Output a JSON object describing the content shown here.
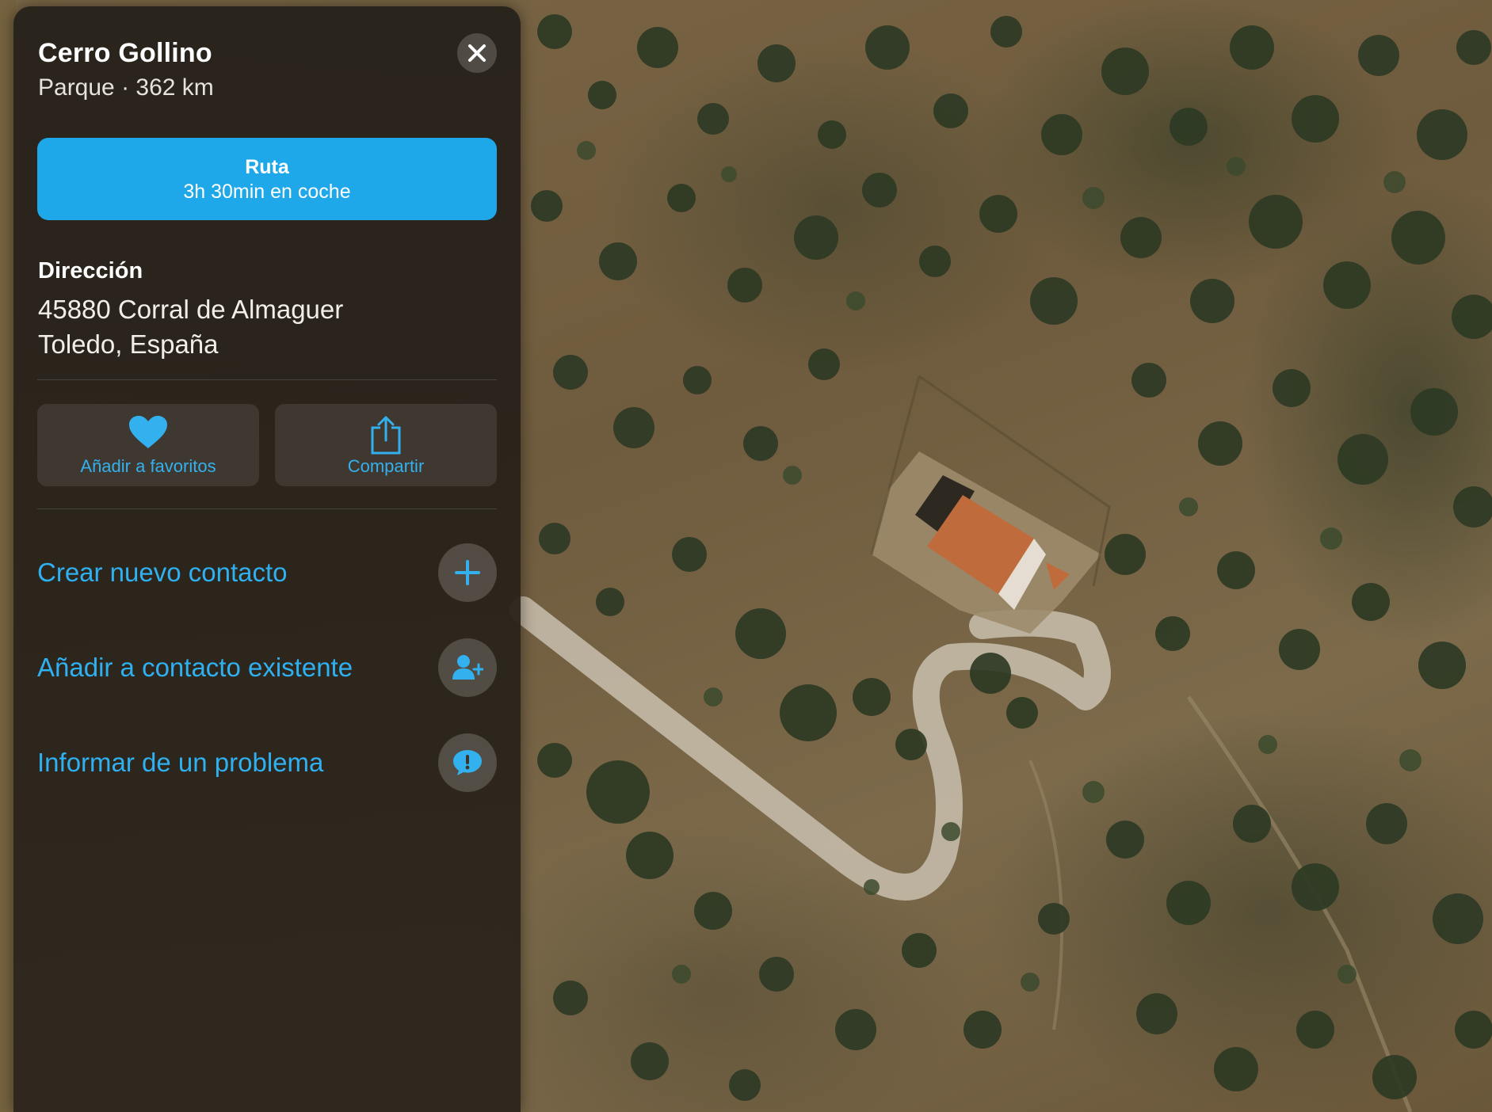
{
  "place": {
    "name": "Cerro Gollino",
    "subtitle": "Parque · 362 km"
  },
  "route": {
    "label": "Ruta",
    "sub": "3h 30min en coche"
  },
  "address": {
    "label": "Dirección",
    "line1": "45880 Corral de Almaguer",
    "line2": "Toledo, España"
  },
  "actions": {
    "favorite": "Añadir a favoritos",
    "share": "Compartir"
  },
  "list": {
    "new_contact": "Crear nuevo contacto",
    "existing_contact": "Añadir a contacto existente",
    "report": "Informar de un problema"
  },
  "icons": {
    "close": "close-icon",
    "heart": "heart-icon",
    "share": "share-icon",
    "plus": "plus-icon",
    "add_person": "add-person-icon",
    "report": "exclamation-bubble-icon"
  },
  "colors": {
    "accent": "#1ea8ea",
    "link": "#2fb0f0",
    "panel": "#2a241b"
  }
}
